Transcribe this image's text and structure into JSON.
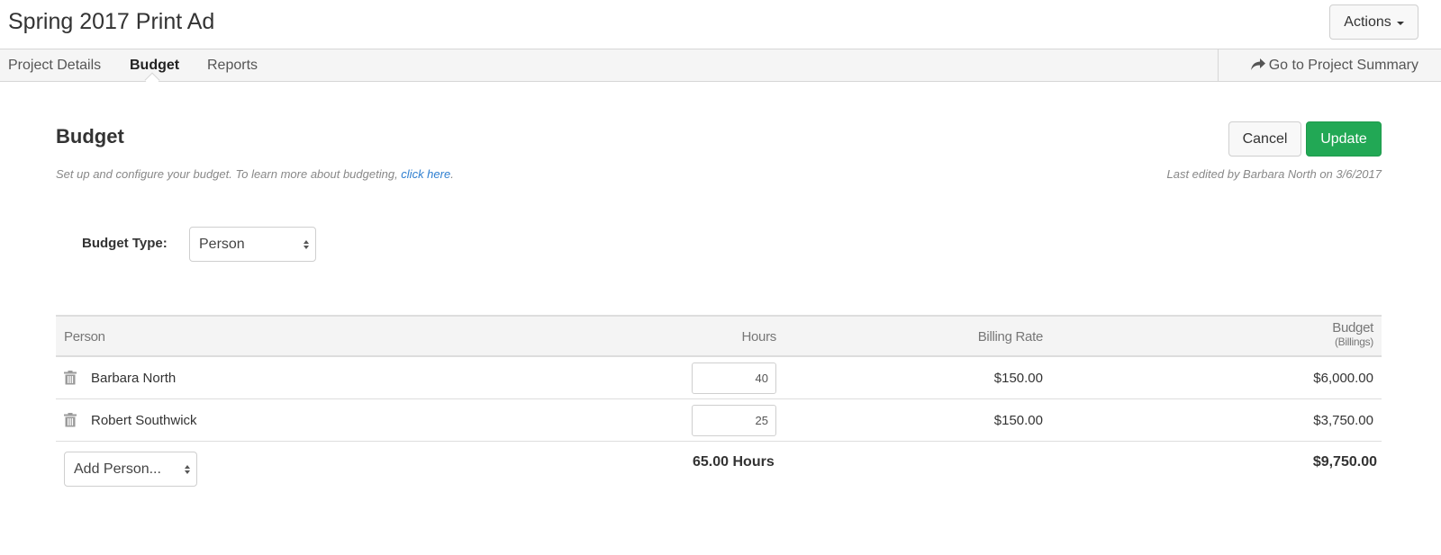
{
  "header": {
    "project_title": "Spring 2017 Print Ad",
    "actions_label": "Actions"
  },
  "tabs": [
    {
      "label": "Project Details",
      "active": false
    },
    {
      "label": "Budget",
      "active": true
    },
    {
      "label": "Reports",
      "active": false
    }
  ],
  "summary_link": {
    "label": "Go to Project Summary",
    "icon": "share-arrow-icon"
  },
  "budget": {
    "title": "Budget",
    "subtitle_text": "Set up and configure your budget. To learn more about budgeting, ",
    "subtitle_link": "click here",
    "subtitle_end": ".",
    "last_edited": "Last edited by Barbara North on 3/6/2017",
    "cancel_label": "Cancel",
    "update_label": "Update",
    "budget_type_label": "Budget Type:",
    "budget_type_value": "Person"
  },
  "colors": {
    "accent_green": "#22a855",
    "link_blue": "#2f7fd0"
  },
  "table": {
    "columns": {
      "person": "Person",
      "hours": "Hours",
      "billing_rate": "Billing Rate",
      "budget": "Budget",
      "budget_sub": "(Billings)"
    },
    "rows": [
      {
        "person": "Barbara North",
        "hours": "40",
        "billing_rate": "$150.00",
        "budget": "$6,000.00"
      },
      {
        "person": "Robert Southwick",
        "hours": "25",
        "billing_rate": "$150.00",
        "budget": "$3,750.00"
      }
    ],
    "add_person_label": "Add Person...",
    "total_hours": "65.00 Hours",
    "total_budget": "$9,750.00"
  }
}
